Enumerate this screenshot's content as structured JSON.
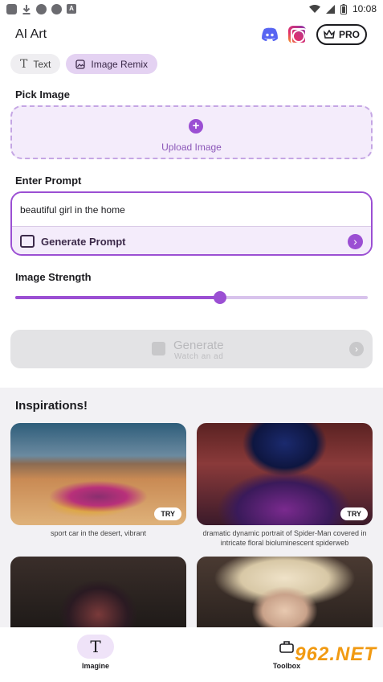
{
  "status_bar": {
    "time": "10:08",
    "notif_letter": "A"
  },
  "app": {
    "title": "AI Art",
    "pro_label": "PRO"
  },
  "tabs": [
    {
      "label": "Text",
      "active": false
    },
    {
      "label": "Image Remix",
      "active": true
    }
  ],
  "pick_image": {
    "label": "Pick Image",
    "upload_label": "Upload Image"
  },
  "prompt": {
    "label": "Enter Prompt",
    "value": "beautiful girl in the home",
    "generate_prompt_label": "Generate Prompt"
  },
  "image_strength": {
    "label": "Image Strength",
    "value": 0.58
  },
  "generate": {
    "label": "Generate",
    "sublabel": "Watch an ad"
  },
  "inspirations": {
    "title": "Inspirations!",
    "cards": [
      {
        "caption": "sport car in the desert, vibrant",
        "badge": "TRY"
      },
      {
        "caption": "dramatic dynamic portrait of Spider-Man covered in intricate floral bioluminescent spiderweb",
        "badge": "TRY"
      },
      {
        "caption": ""
      },
      {
        "caption": ""
      }
    ]
  },
  "bottom_nav": {
    "imagine_label": "Imagine",
    "toolbox_label": "Toolbox"
  },
  "watermark": "962.NET",
  "colors": {
    "accent": "#9b4fd3",
    "accent_light": "#f4ecfb",
    "tab_active": "#e4d2f2"
  }
}
